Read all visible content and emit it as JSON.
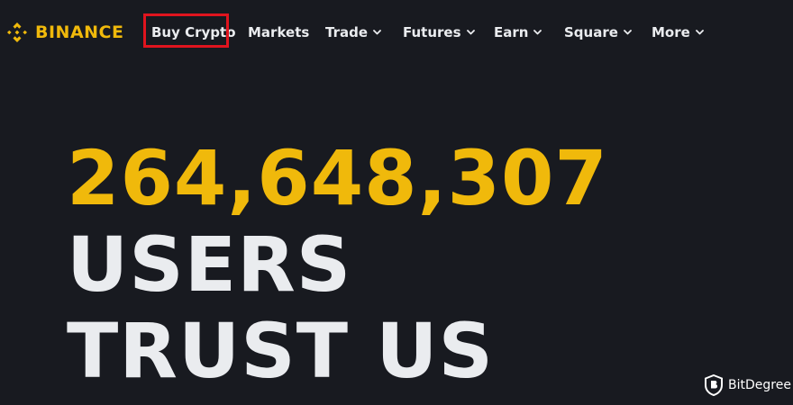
{
  "brand": {
    "name": "BINANCE",
    "color": "#f0b90b",
    "icon": "binance-diamond-logo"
  },
  "nav": {
    "items": [
      {
        "label": "Buy Crypto",
        "has_dropdown": false,
        "highlighted": true
      },
      {
        "label": "Markets",
        "has_dropdown": false
      },
      {
        "label": "Trade",
        "has_dropdown": true
      },
      {
        "label": "Futures",
        "has_dropdown": true
      },
      {
        "label": "Earn",
        "has_dropdown": true
      },
      {
        "label": "Square",
        "has_dropdown": true
      },
      {
        "label": "More",
        "has_dropdown": true
      }
    ],
    "dropdown_icon": "chevron-down-icon",
    "highlight_color": "#e0141e"
  },
  "hero": {
    "user_count": "264,648,307",
    "line2": "USERS",
    "line3": "TRUST US",
    "count_color": "#f0b90b",
    "text_color": "#eaecef"
  },
  "watermark": {
    "label": "BitDegree",
    "icon": "bitdegree-shield-icon"
  },
  "colors": {
    "background": "#181a20"
  }
}
